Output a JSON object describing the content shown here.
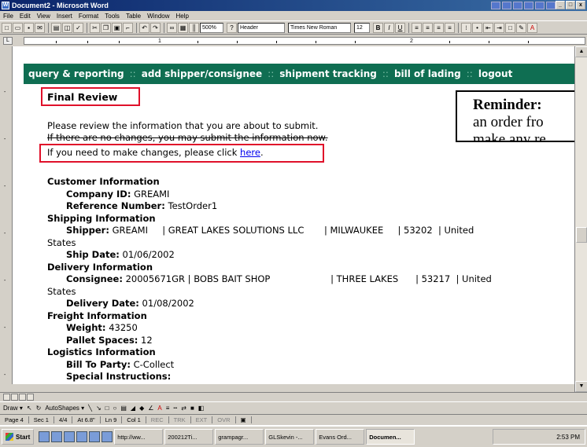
{
  "window": {
    "title": "Document2 - Microsoft Word",
    "controls": {
      "minimize": "_",
      "maximize": "□",
      "close": "x"
    }
  },
  "menu": [
    "File",
    "Edit",
    "View",
    "Insert",
    "Format",
    "Tools",
    "Table",
    "Window",
    "Help"
  ],
  "toolbar": {
    "zoom": "500%",
    "style": "Header",
    "font": "Times New Roman",
    "size": "12"
  },
  "ruler": {
    "marks": [
      "1",
      "2"
    ]
  },
  "vruler": {
    "marks": [
      "-",
      "-",
      "-",
      "-",
      "-",
      "-",
      "-"
    ]
  },
  "navbar": {
    "links": [
      "query & reporting",
      "add shipper/consignee",
      "shipment tracking",
      "bill of lading",
      "logout"
    ],
    "separator": "::"
  },
  "page": {
    "heading": "Final Review",
    "intro_line1": "Please review the information that you are about to submit.",
    "intro_line2": "If there are no changes, you may submit the information now.",
    "intro_line3_prefix": "If you need to make changes, please click ",
    "intro_line3_link": "here",
    "intro_line3_suffix": "."
  },
  "customer": {
    "heading": "Customer Information",
    "company_id_label": "Company ID:",
    "company_id": " GREAMI",
    "reference_label": "Reference Number:",
    "reference": " TestOrder1"
  },
  "shipping": {
    "heading": "Shipping Information",
    "shipper_label": "Shipper:",
    "shipper": " GREAMI     | GREAT LAKES SOLUTIONS LLC       | MILWAUKEE     | 53202  | United",
    "shipper_wrap": "States",
    "ship_date_label": "Ship Date:",
    "ship_date": " 01/06/2002"
  },
  "delivery": {
    "heading": "Delivery Information",
    "consignee_label": "Consignee:",
    "consignee": " 20005671GR | BOBS BAIT SHOP                     | THREE LAKES      | 53217  | United",
    "consignee_wrap": "States",
    "delivery_date_label": "Delivery Date:",
    "delivery_date": " 01/08/2002"
  },
  "freight": {
    "heading": "Freight Information",
    "weight_label": "Weight:",
    "weight": " 43250",
    "pallets_label": "Pallet Spaces:",
    "pallets": " 12"
  },
  "logistics": {
    "heading": "Logistics Information",
    "bill_to_label": "Bill To Party:",
    "bill_to": " C-Collect",
    "special_label": "Special Instructions:"
  },
  "reminder": {
    "title": "Reminder:",
    "line2": "an order fro",
    "line3": "make any re"
  },
  "drawbar": {
    "draw": "Draw ▾",
    "autoshapes": "AutoShapes ▾"
  },
  "status": {
    "page": "Page 4",
    "sec": "Sec 1",
    "pages": "4/4",
    "at": "At 6.8\"",
    "ln": "Ln 9",
    "col": "Col 1",
    "rec": "REC",
    "trk": "TRK",
    "ext": "EXT",
    "ovr": "OVR"
  },
  "taskbar": {
    "start": "Start",
    "tasks": [
      "http://ww...",
      "200212Ti...",
      "grampagr...",
      "GLSkevin -...",
      "Evans Ord...",
      "Documen..."
    ],
    "clock": "2:53 PM"
  }
}
